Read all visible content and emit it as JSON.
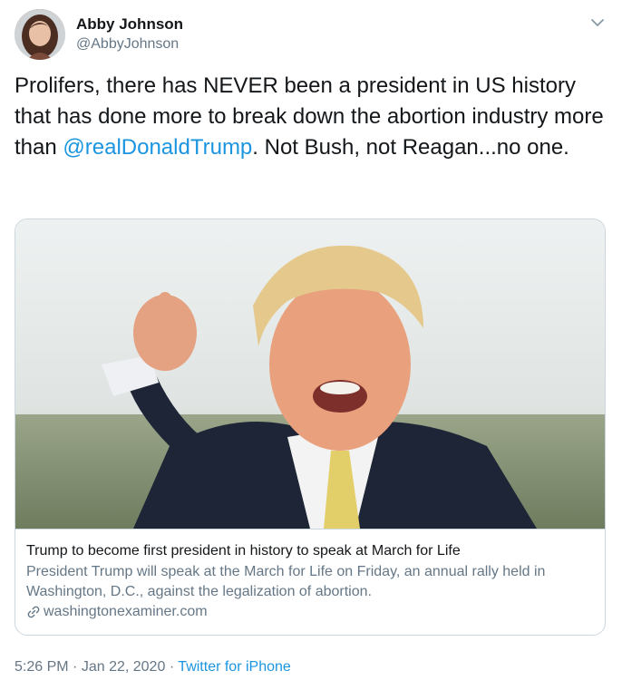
{
  "author": {
    "display_name": "Abby Johnson",
    "handle": "@AbbyJohnson"
  },
  "tweet": {
    "text_before_mention": "Prolifers, there has NEVER been a president in US history that has done more to break down the abortion industry more than ",
    "mention": "@realDonaldTrump",
    "text_after_mention": ". Not Bush, not Reagan...no one."
  },
  "card": {
    "title": "Trump to become first president in history to speak at March for Life",
    "description": "President Trump will speak at the March for Life on Friday, an annual rally held in Washington, D.C., against the legalization of abortion.",
    "domain": "washingtonexaminer.com"
  },
  "meta": {
    "time": "5:26 PM",
    "separator1": "·",
    "date": "Jan 22, 2020",
    "separator2": "·",
    "source": "Twitter for iPhone"
  },
  "colors": {
    "link": "#1b95e0",
    "secondary_text": "#657786",
    "border": "#ccd6dd"
  },
  "icons": {
    "caret": "chevron-down-icon",
    "link": "link-icon"
  }
}
